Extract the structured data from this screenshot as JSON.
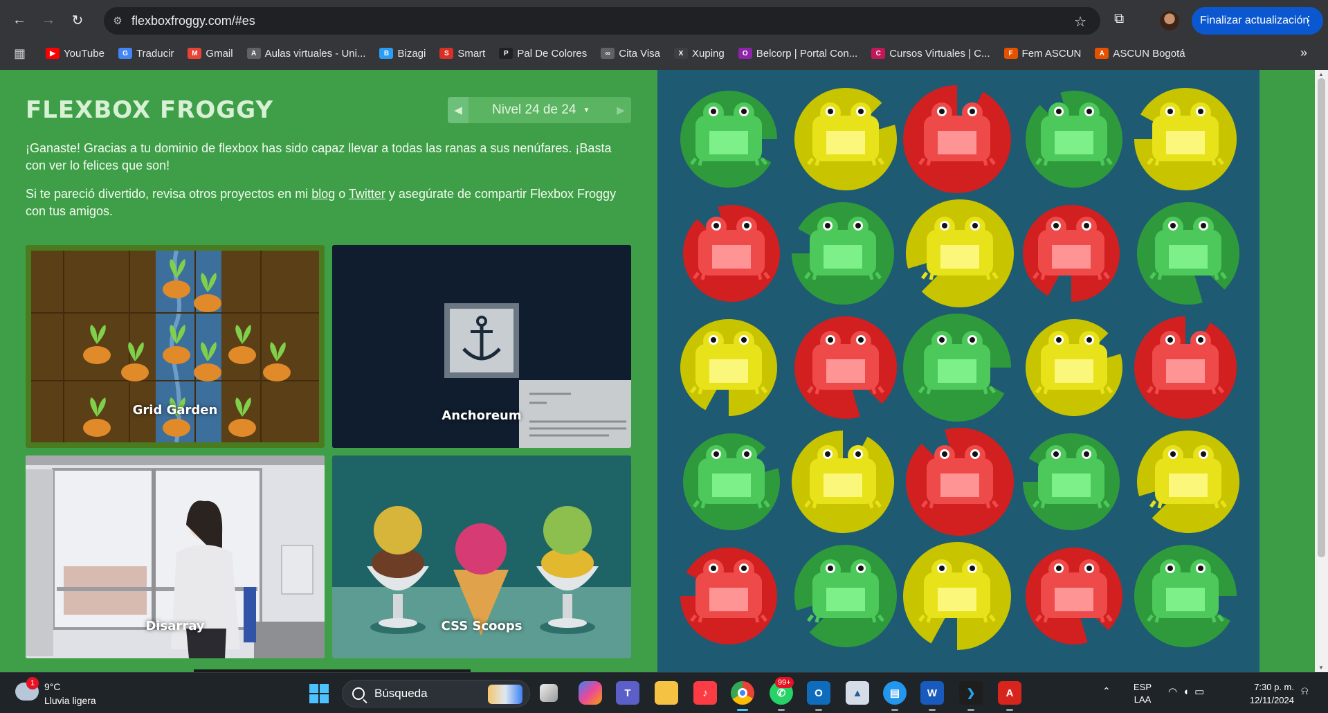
{
  "browser": {
    "url": "flexboxfroggy.com/#es",
    "update_label": "Finalizar actualización",
    "bookmarks": [
      {
        "label": "YouTube",
        "color": "#ff0000",
        "glyph": "▶"
      },
      {
        "label": "Traducir",
        "color": "#4285f4",
        "glyph": "G"
      },
      {
        "label": "Gmail",
        "color": "#ea4335",
        "glyph": "M"
      },
      {
        "label": "Aulas virtuales - Uni...",
        "color": "#5f6368",
        "glyph": "A"
      },
      {
        "label": "Bizagi",
        "color": "#2a9df4",
        "glyph": "B"
      },
      {
        "label": "Smart",
        "color": "#d93025",
        "glyph": "S"
      },
      {
        "label": "Pal De Colores",
        "color": "#202124",
        "glyph": "P"
      },
      {
        "label": "Cita Visa",
        "color": "#5f6368",
        "glyph": "∞"
      },
      {
        "label": "Xuping",
        "color": "#3c4043",
        "glyph": "X"
      },
      {
        "label": "Belcorp | Portal Con...",
        "color": "#8e24aa",
        "glyph": "O"
      },
      {
        "label": "Cursos Virtuales | C...",
        "color": "#c2185b",
        "glyph": "C"
      },
      {
        "label": "Fem ASCUN",
        "color": "#e65100",
        "glyph": "F"
      },
      {
        "label": "ASCUN Bogotá",
        "color": "#e65100",
        "glyph": "A"
      }
    ]
  },
  "game": {
    "title": "FLEXBOX FROGGY",
    "level_label": "Nivel 24 de 24",
    "paragraph1": "¡Ganaste! Gracias a tu dominio de flexbox has sido capaz llevar a todas las ranas a sus nenúfares. ¡Basta con ver lo felices que son!",
    "paragraph2_before": "Si te pareció divertido, revisa otros proyectos en mi ",
    "blog_link": "blog",
    "paragraph2_mid": " o ",
    "twitter_link": "Twitter",
    "paragraph2_after": " y asegúrate de compartir Flexbox Froggy con tus amigos.",
    "cards": {
      "grid": "Grid Garden",
      "anchor": "Anchoreum",
      "disarray": "Disarray",
      "scoops": "CSS Scoops"
    },
    "frog_colors": {
      "green": {
        "pad": "#2f9a3b",
        "body": "#4cc95a",
        "belly": "#7ef08a"
      },
      "yellow": {
        "pad": "#c9c400",
        "body": "#e8e21a",
        "belly": "#fbf77a"
      },
      "red": {
        "pad": "#d21f1f",
        "body": "#ee4a4a",
        "belly": "#ff9494"
      }
    },
    "pond_grid": [
      [
        "green",
        "yellow",
        "red",
        "green",
        "yellow"
      ],
      [
        "red",
        "green",
        "yellow",
        "red",
        "green"
      ],
      [
        "yellow",
        "red",
        "green",
        "yellow",
        "red"
      ],
      [
        "green",
        "yellow",
        "red",
        "green",
        "yellow"
      ],
      [
        "red",
        "green",
        "yellow",
        "red",
        "green"
      ]
    ]
  },
  "taskbar": {
    "weather_badge": "1",
    "weather_temp": "9°C",
    "weather_desc": "Lluvia ligera",
    "search_placeholder": "Búsqueda",
    "whatsapp_badge": "99+",
    "lang_line1": "ESP",
    "lang_line2": "LAA",
    "time": "7:30 p. m.",
    "date": "12/11/2024"
  }
}
